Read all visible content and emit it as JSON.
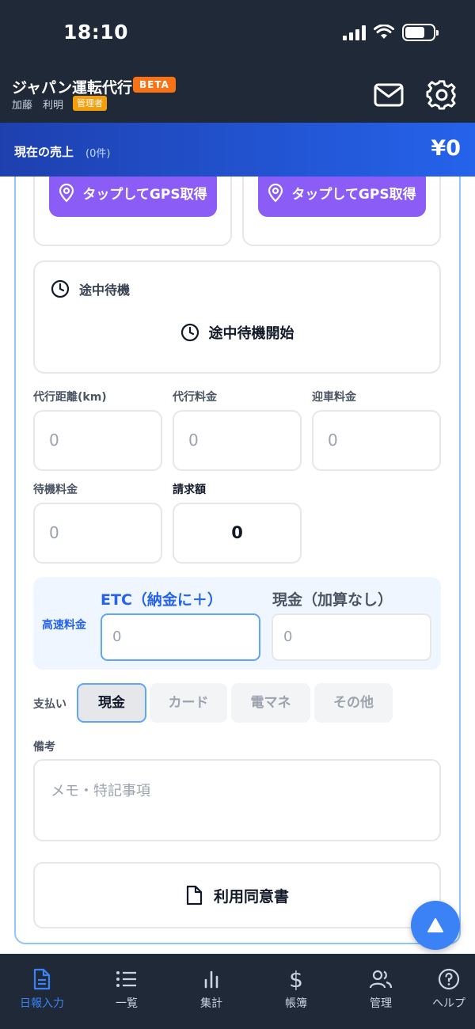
{
  "status_bar": {
    "time": "18:10"
  },
  "header": {
    "title": "ジャパン運転代行",
    "beta": "BETA",
    "user": "加藤　利明",
    "role": "管理者"
  },
  "sales": {
    "label": "現在の売上",
    "count": "(0件)",
    "amount": "¥0"
  },
  "gps": {
    "button_label": "タップしてGPS取得"
  },
  "wait": {
    "title": "途中待機",
    "start_label": "途中待機開始"
  },
  "fields": {
    "distance": {
      "label": "代行距離(km)",
      "placeholder": "0"
    },
    "fee": {
      "label": "代行料金",
      "placeholder": "0"
    },
    "pickup": {
      "label": "迎車料金",
      "placeholder": "0"
    },
    "waiting_fee": {
      "label": "待機料金",
      "placeholder": "0"
    },
    "billing": {
      "label": "請求額",
      "value": "0"
    }
  },
  "highway": {
    "label": "高速料金",
    "etc_label": "ETC（納金に＋）",
    "etc_placeholder": "0",
    "cash_label": "現金（加算なし）",
    "cash_placeholder": "0"
  },
  "payment": {
    "label": "支払い",
    "options": [
      "現金",
      "カード",
      "電マネ",
      "その他"
    ],
    "selected": "現金"
  },
  "memo": {
    "label": "備考",
    "placeholder": "メモ・特記事項"
  },
  "consent": {
    "label": "利用同意書"
  },
  "tabs": [
    {
      "label": "日報入力",
      "icon": "document-icon",
      "active": true
    },
    {
      "label": "一覧",
      "icon": "list-icon",
      "active": false
    },
    {
      "label": "集計",
      "icon": "bar-chart-icon",
      "active": false
    },
    {
      "label": "帳簿",
      "icon": "dollar-icon",
      "active": false
    },
    {
      "label": "管理",
      "icon": "users-icon",
      "active": false
    },
    {
      "label": "ヘルプ",
      "icon": "help-icon",
      "active": false
    }
  ],
  "colors": {
    "header_bg": "#1f2937",
    "sales_bar": "#2563eb",
    "gps_button": "#8b5cf6",
    "beta_badge": "#f97316",
    "role_badge": "#f59e0b",
    "active_tab": "#3b82f6"
  }
}
